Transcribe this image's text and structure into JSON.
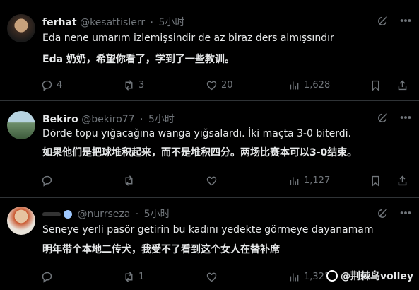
{
  "tweets": [
    {
      "name": "ferhat",
      "handle": "@kesattislerr",
      "dot": "·",
      "time": "5小时",
      "text": "Eda nene umarım izlemişsindir de az biraz ders almışsındır",
      "translation": "Eda 奶奶，希望你看了，学到了一些教训。",
      "replies": "4",
      "reposts": "3",
      "likes": "20",
      "views": "1,628"
    },
    {
      "name": "Bekiro",
      "handle": "@bekiro77",
      "dot": "·",
      "time": "5小时",
      "text": "Dörde topu yığacağına wanga yığsalardı. İki maçta 3-0 biterdi.",
      "translation": "如果他们是把球堆积起来，而不是堆积四分。两场比赛本可以3-0结束。",
      "replies": "",
      "reposts": "",
      "likes": "",
      "views": "1,127"
    },
    {
      "name": "",
      "handle": "@nurrseza",
      "dot": "·",
      "time": "5小时",
      "text": "Seneye yerli pasör getirin bu kadını yedekte görmeye dayanamam",
      "translation": "明年带个本地二传犬，我受不了看到这个女人在替补席",
      "replies": "",
      "reposts": "1",
      "likes": "",
      "views": "1,321"
    }
  ],
  "watermark": "@荆棘鸟volley",
  "icons": {
    "grok": "grok-icon",
    "more": "more-icon",
    "reply": "reply-icon",
    "repost": "repost-icon",
    "like": "heart-icon",
    "views": "views-icon",
    "bookmark": "bookmark-icon",
    "share": "share-icon"
  }
}
